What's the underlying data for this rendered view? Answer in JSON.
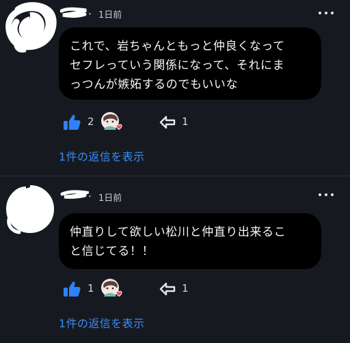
{
  "colors": {
    "background": "#161a20",
    "bubble": "#000000",
    "link": "#3b8df5",
    "like": "#2f81f7",
    "heart": "#e5485d"
  },
  "icons": {
    "like": "thumbs-up-icon",
    "reply": "reply-arrow-icon",
    "more": "more-horizontal-icon"
  },
  "separator": "・",
  "comments": [
    {
      "time": "1日前",
      "text": "これで、岩ちゃんともっと仲良くなって\nセフレっていう関係になって、それにま\nっつんが嫉妬するのでもいいな",
      "likes": "2",
      "replies": "1",
      "replies_link": "1件の返信を表示"
    },
    {
      "time": "1日前",
      "text": "仲直りして欲しい松川と仲直り出来るこ\nと信じてる！！",
      "likes": "1",
      "replies": "1",
      "replies_link": "1件の返信を表示"
    }
  ]
}
